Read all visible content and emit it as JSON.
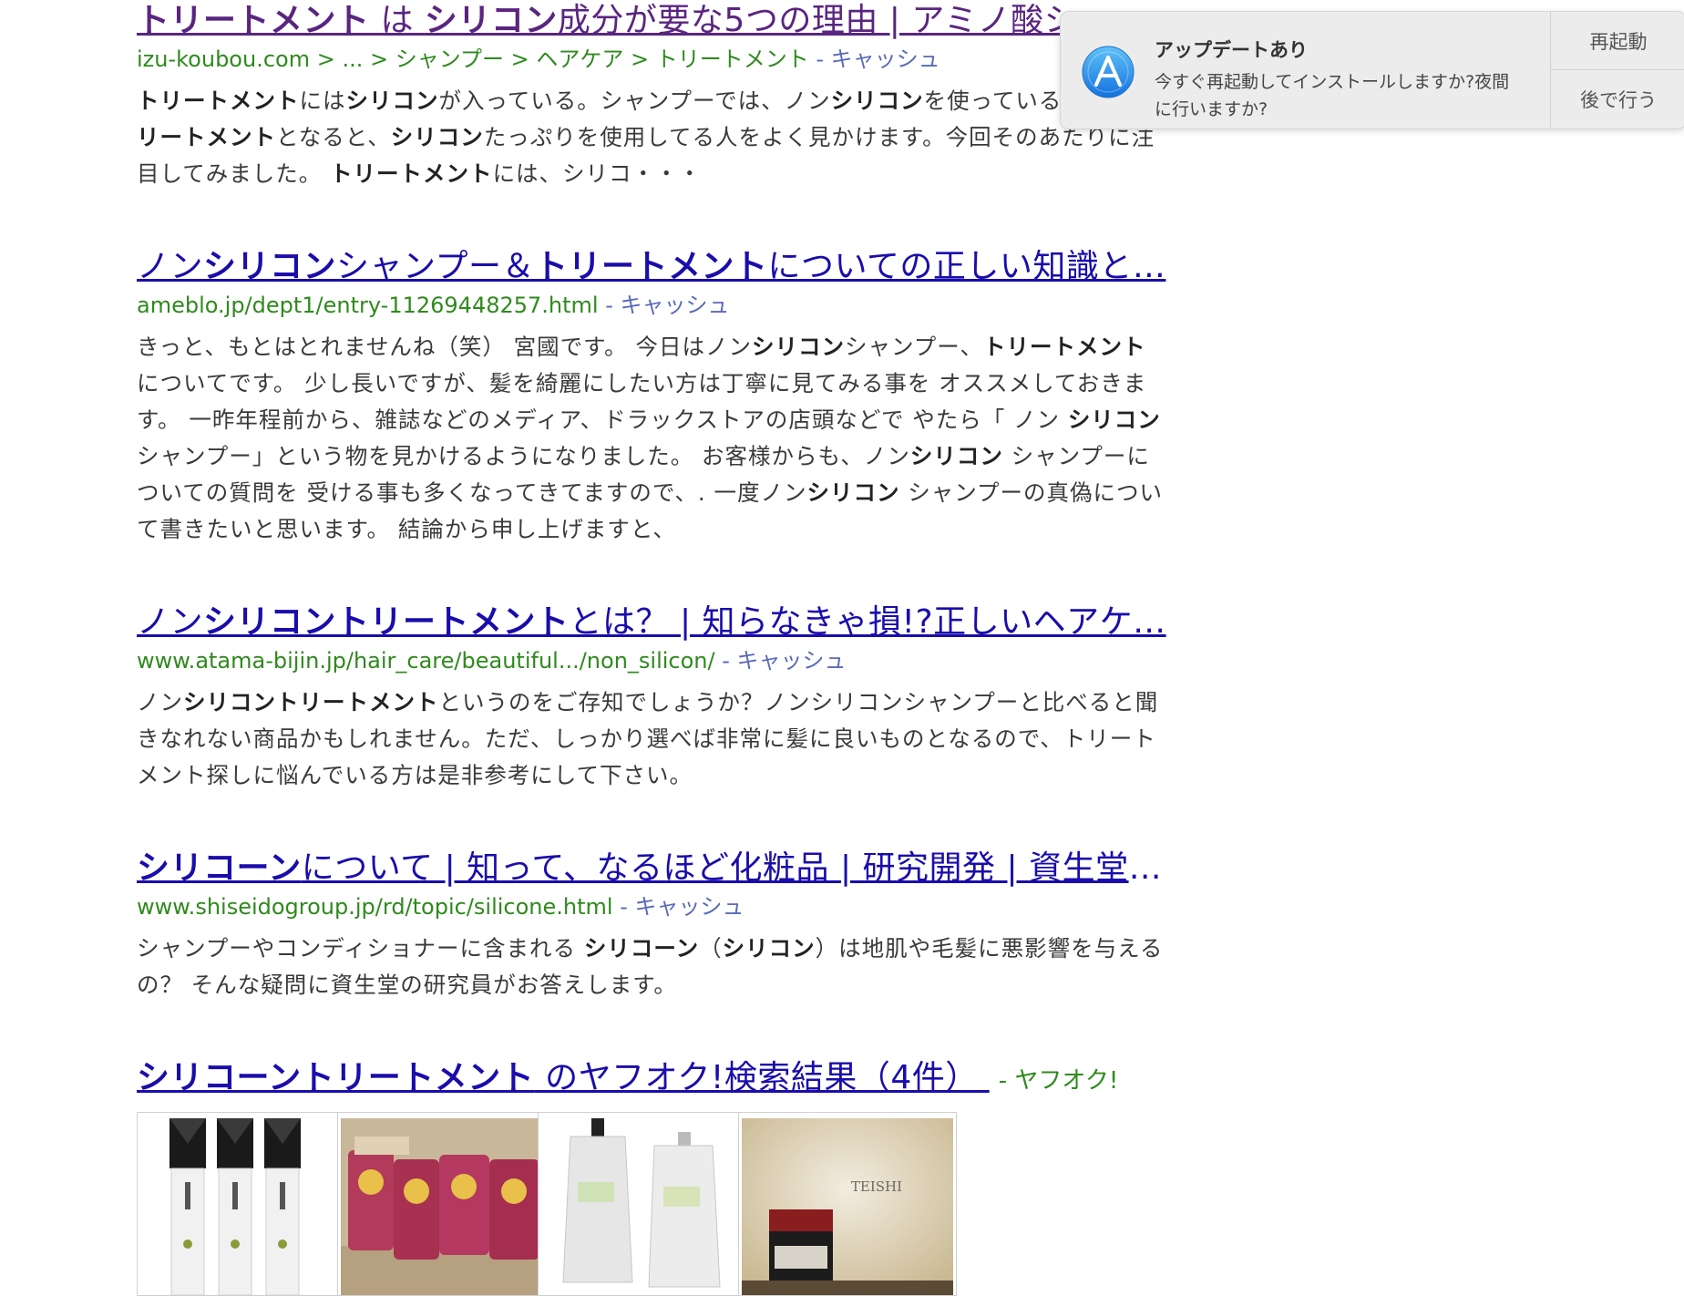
{
  "results": [
    {
      "title": [
        {
          "t": "トリートメント",
          "b": true
        },
        {
          "t": " は ",
          "b": false
        },
        {
          "t": "シリコン",
          "b": true
        },
        {
          "t": "成分が要な5つの理由 | アミノ酸シャンプー",
          "b": false
        }
      ],
      "url": "izu-koubou.com > ... > シャンプー > ヘアケア > トリートメント",
      "cache": " - キャッシュ",
      "snippet": [
        {
          "t": "トリートメント",
          "b": true
        },
        {
          "t": "には",
          "b": false
        },
        {
          "t": "シリコン",
          "b": true
        },
        {
          "t": "が入っている。シャンプーでは、ノン",
          "b": false
        },
        {
          "t": "シリコン",
          "b": true
        },
        {
          "t": "を使っている人も、",
          "b": false
        },
        {
          "t": "トリートメント",
          "b": true
        },
        {
          "t": "となると、",
          "b": false
        },
        {
          "t": "シリコン",
          "b": true
        },
        {
          "t": "たっぷりを使用してる人をよく見かけます。今回そのあたりに注目してみました。 ",
          "b": false
        },
        {
          "t": "トリートメント",
          "b": true
        },
        {
          "t": "には、シリコ・・・",
          "b": false
        }
      ]
    },
    {
      "title": [
        {
          "t": "ノン",
          "b": false
        },
        {
          "t": "シリコン",
          "b": true
        },
        {
          "t": "シャンプー＆",
          "b": false
        },
        {
          "t": "トリートメント",
          "b": true
        },
        {
          "t": "についての正しい知識と…",
          "b": false
        }
      ],
      "url": "ameblo.jp/dept1/entry-11269448257.html",
      "cache": " - キャッシュ",
      "snippet": [
        {
          "t": "きっと、もとはとれませんね（笑） 宮國です。 今日はノン",
          "b": false
        },
        {
          "t": "シリコン",
          "b": true
        },
        {
          "t": "シャンプー、",
          "b": false
        },
        {
          "t": "トリートメント",
          "b": true
        },
        {
          "t": "についてです。 少し長いですが、髪を綺麗にしたい方は丁寧に見てみる事を オススメしておきます。 一昨年程前から、雑誌などのメディア、ドラックストアの店頭などで やたら「 ノン ",
          "b": false
        },
        {
          "t": "シリコン",
          "b": true
        },
        {
          "t": "シャンプー」という物を見かけるようになりました。 お客様からも、ノン",
          "b": false
        },
        {
          "t": "シリコン",
          "b": true
        },
        {
          "t": " シャンプーについての質問を 受ける事も多くなってきてますので、. 一度ノン",
          "b": false
        },
        {
          "t": "シリコン",
          "b": true
        },
        {
          "t": " シャンプーの真偽について書きたいと思います。 結論から申し上げますと、",
          "b": false
        }
      ]
    },
    {
      "title": [
        {
          "t": "ノン",
          "b": false
        },
        {
          "t": "シリコントリートメント",
          "b": true
        },
        {
          "t": "とは？ | 知らなきゃ損!?正しいヘアケ…",
          "b": false
        }
      ],
      "url": "www.atama-bijin.jp/hair_care/beautiful.../non_silicon/",
      "cache": " - キャッシュ",
      "snippet": [
        {
          "t": "ノン",
          "b": false
        },
        {
          "t": "シリコントリートメント",
          "b": true
        },
        {
          "t": "というのをご存知でしょうか？ノンシリコンシャンプーと比べると聞きなれない商品かもしれません。ただ、しっかり選べば非常に髪に良いものとなるので、トリートメント探しに悩んでいる方は是非参考にして下さい。",
          "b": false
        }
      ]
    },
    {
      "title": [
        {
          "t": "シリコーン",
          "b": true
        },
        {
          "t": "について | 知って、なるほど化粧品 | 研究開発 | 資生堂 ...",
          "b": false
        }
      ],
      "url": "www.shiseidogroup.jp/rd/topic/silicone.html",
      "cache": " - キャッシュ",
      "snippet": [
        {
          "t": "シャンプーやコンディショナーに含まれる ",
          "b": false
        },
        {
          "t": "シリコーン",
          "b": true
        },
        {
          "t": "（",
          "b": false
        },
        {
          "t": "シリコン",
          "b": true
        },
        {
          "t": "）は地肌や毛髪に悪影響を与えるの？ そんな疑問に資生堂の研究員がお答えします。",
          "b": false
        }
      ]
    }
  ],
  "yahoo": {
    "title": [
      {
        "t": "シリコーントリートメント",
        "b": true
      },
      {
        "t": " のヤフオク!検索結果（4件） ",
        "b": false
      }
    ],
    "source": "- ヤフオク!",
    "thumbs": [
      "serum-bottles-image",
      "refill-packs-image",
      "pouch-image",
      "teishi-jar-image"
    ],
    "teishi_label": "TEISHI"
  },
  "notification": {
    "title": "アップデートあり",
    "message": "今すぐ再起動してインストールしますか?夜間に行いますか?",
    "restart": "再起動",
    "later": "後で行う",
    "icon": "app-store-icon"
  }
}
